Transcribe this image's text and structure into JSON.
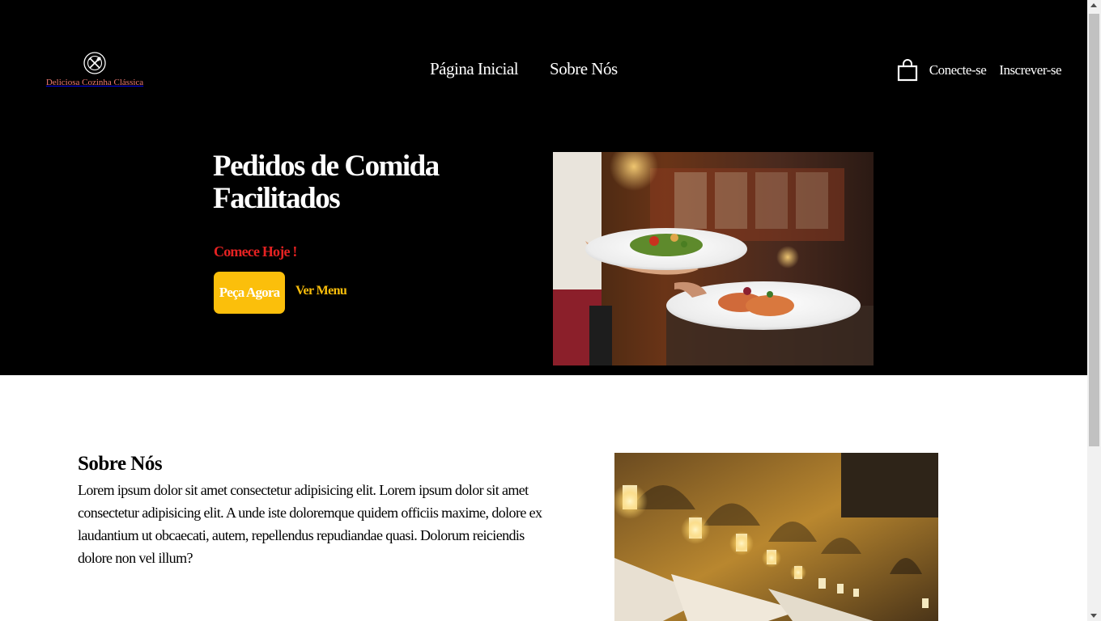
{
  "header": {
    "brand": "Deliciosa Cozinha Clássica",
    "logo_icon": "fork-knife-plate-icon",
    "nav": [
      {
        "label": "Página Inicial"
      },
      {
        "label": "Sobre Nós"
      }
    ],
    "cart_icon": "shopping-bag-icon",
    "login_label": "Conecte-se",
    "signup_label": "Inscrever-se"
  },
  "hero": {
    "title": "Pedidos de Comida Facilitados",
    "subtitle": "Comece Hoje !",
    "order_button": "Peça Agora",
    "menu_link": "Ver Menu",
    "image": "waiter-serving-dishes-photo"
  },
  "about": {
    "title": "Sobre Nós",
    "text": "Lorem ipsum dolor sit amet consectetur adipisicing elit. Lorem ipsum dolor sit amet consectetur adipisicing elit. A unde iste doloremque quidem officiis maxime, dolore ex laudantium ut obcaecati, autem, repellendus repudiandae quasi. Dolorum reiciendis dolore non vel illum?",
    "image": "restaurant-street-night-photo"
  },
  "colors": {
    "hero_bg": "#000000",
    "brand": "#f07a72",
    "accent_red": "#e52222",
    "accent_yellow": "#fbbf0b"
  }
}
